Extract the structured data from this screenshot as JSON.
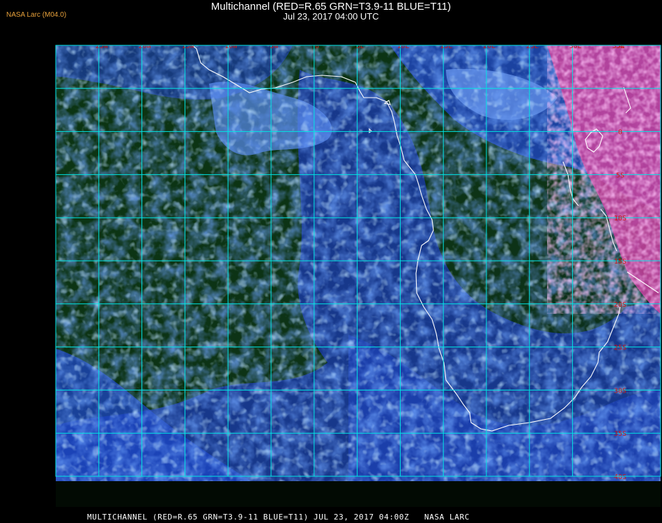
{
  "header": {
    "title": "Multichannel (RED=R.65 GRN=T3.9-11 BLUE=T11)",
    "subtitle": "Jul 23, 2017 04:00 UTC",
    "credit": "NASA Larc (M04.0)"
  },
  "footer": {
    "text": "MULTICHANNEL (RED=R.65 GRN=T3.9-11 BLUE=T11) JUL 23, 2017 04:00Z   NASA LARC"
  },
  "map": {
    "longitude_labels": [
      "25W",
      "20W",
      "15W",
      "10W",
      "5W",
      "0",
      "5E",
      "10E",
      "15E",
      "20E",
      "25E",
      "30E",
      "35E"
    ],
    "latitude_labels": [
      "5N",
      "0",
      "5S",
      "10S",
      "15S",
      "20S",
      "25S",
      "30S",
      "35S",
      "40S"
    ],
    "colors": {
      "grid": "#00e5e5",
      "grid_label": "#c81a1a",
      "coastline": "#ffffff",
      "ocean_clear": "#0c2f12",
      "cloud_low": "#1e44c8",
      "cloud_high": "#7fb4ff",
      "land_day": "#e050c8"
    }
  }
}
